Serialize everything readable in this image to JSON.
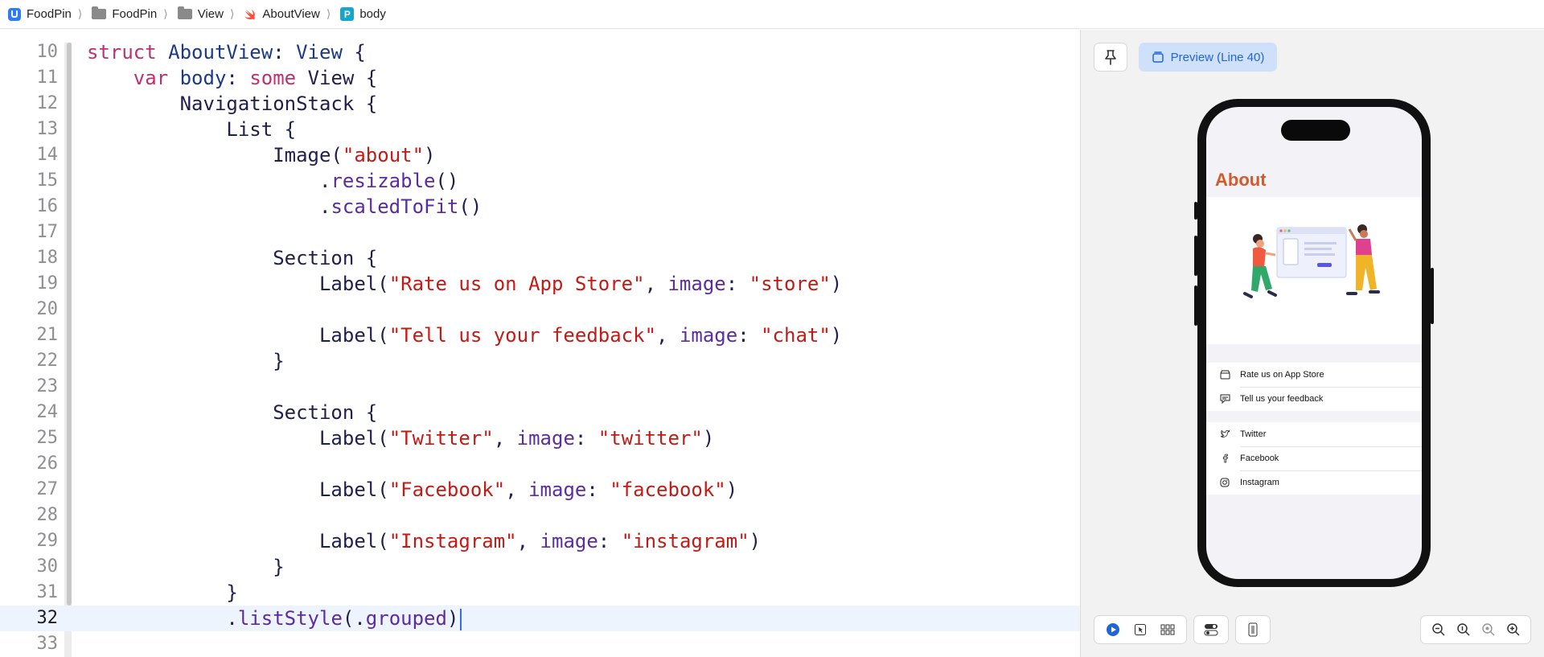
{
  "breadcrumb": {
    "items": [
      {
        "label": "FoodPin",
        "icon": "app-icon"
      },
      {
        "label": "FoodPin",
        "icon": "folder-icon"
      },
      {
        "label": "View",
        "icon": "folder-icon"
      },
      {
        "label": "AboutView",
        "icon": "swift-file-icon"
      },
      {
        "label": "body",
        "icon": "property-icon"
      }
    ],
    "separator": "⟩",
    "property_badge": "P"
  },
  "editor": {
    "current_line": "32",
    "lines": [
      {
        "num": "10"
      },
      {
        "num": "11"
      },
      {
        "num": "12"
      },
      {
        "num": "13"
      },
      {
        "num": "14"
      },
      {
        "num": "15"
      },
      {
        "num": "16"
      },
      {
        "num": "17"
      },
      {
        "num": "18"
      },
      {
        "num": "19"
      },
      {
        "num": "20"
      },
      {
        "num": "21"
      },
      {
        "num": "22"
      },
      {
        "num": "23"
      },
      {
        "num": "24"
      },
      {
        "num": "25"
      },
      {
        "num": "26"
      },
      {
        "num": "27"
      },
      {
        "num": "28"
      },
      {
        "num": "29"
      },
      {
        "num": "30"
      },
      {
        "num": "31"
      },
      {
        "num": "32"
      },
      {
        "num": "33"
      }
    ],
    "tokens": {
      "struct": "struct",
      "AboutView": "AboutView",
      "View": "View",
      "var": "var",
      "body": "body",
      "some": "some",
      "NavigationStack": "NavigationStack",
      "List": "List",
      "Image": "Image",
      "about": "\"about\"",
      "resizable": "resizable",
      "scaledToFit": "scaledToFit",
      "Section": "Section",
      "Label": "Label",
      "image": "image",
      "rate": "\"Rate us on App Store\"",
      "store": "\"store\"",
      "feedback": "\"Tell us your feedback\"",
      "chat": "\"chat\"",
      "twitter_label": "\"Twitter\"",
      "twitter_img": "\"twitter\"",
      "facebook_label": "\"Facebook\"",
      "facebook_img": "\"facebook\"",
      "instagram_label": "\"Instagram\"",
      "instagram_img": "\"instagram\"",
      "listStyle": "listStyle",
      "grouped": "grouped"
    }
  },
  "canvas": {
    "pin_icon": "pin-icon",
    "preview_label": "Preview (Line 40)",
    "accent": "#2166d4",
    "device": {
      "nav_title": "About",
      "title_color": "#d45a2a",
      "section1": [
        {
          "label": "Rate us on App Store",
          "icon": "store-icon"
        },
        {
          "label": "Tell us your feedback",
          "icon": "chat-icon"
        }
      ],
      "section2": [
        {
          "label": "Twitter",
          "icon": "twitter-icon"
        },
        {
          "label": "Facebook",
          "icon": "facebook-icon"
        },
        {
          "label": "Instagram",
          "icon": "instagram-icon"
        }
      ]
    },
    "bottom_toolbar": [
      "live-play-icon",
      "selectable-icon",
      "variants-grid-icon",
      "canvas-settings-icon",
      "device-icon",
      "zoom-out-icon",
      "zoom-100-icon",
      "zoom-fit-icon",
      "zoom-in-icon"
    ]
  }
}
